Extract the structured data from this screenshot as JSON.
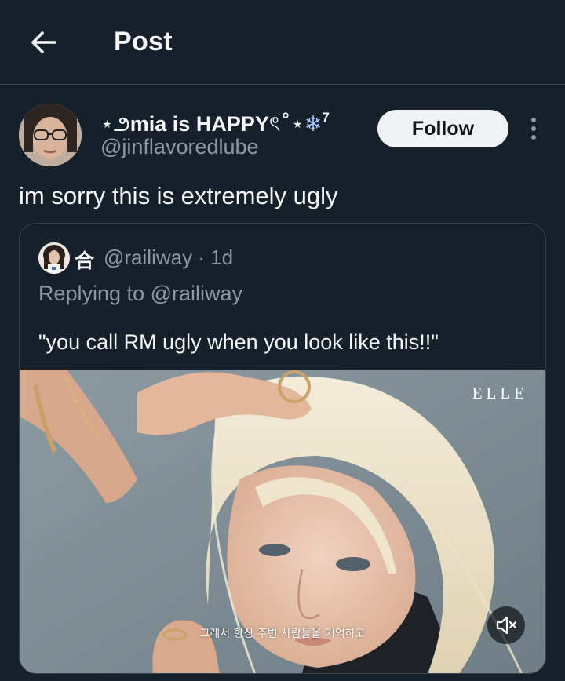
{
  "header": {
    "title": "Post",
    "back_icon": "arrow-left-icon"
  },
  "post": {
    "author": {
      "name_prefix": "⋆౨",
      "name_main": "mia is HAPPY",
      "name_suffix": "ৎ˚⋆",
      "name_snowflake": "❄",
      "name_sup": "7",
      "handle": "@jinflavoredlube"
    },
    "follow_label": "Follow",
    "more_icon": "more-vertical-icon",
    "text": "im sorry this is extremely ugly",
    "quote": {
      "name": "合",
      "handle_time": "@railiway · 1d",
      "replying_to": "Replying to @railiway",
      "text": "\"you call RM ugly when you look like this!!\"",
      "media": {
        "watermark": "ELLE",
        "subtitle": "그래서 항상 주변 사람들을 기억하고",
        "mute_icon": "volume-mute-icon"
      }
    }
  },
  "colors": {
    "background": "#15202b",
    "divider": "#38444d",
    "muted_text": "#8b98a5",
    "follow_bg": "#eff3f4"
  }
}
